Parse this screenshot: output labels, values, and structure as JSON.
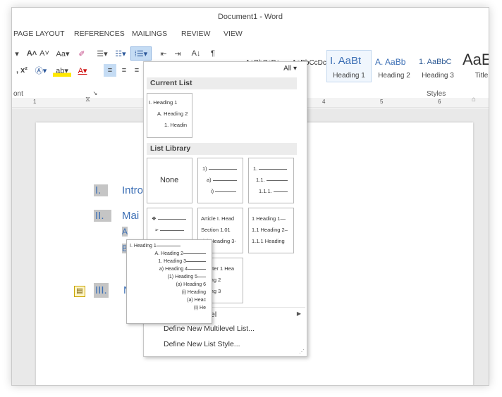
{
  "window": {
    "title": "Document1 - Word"
  },
  "tabs": [
    "PAGE LAYOUT",
    "REFERENCES",
    "MAILINGS",
    "REVIEW",
    "VIEW"
  ],
  "ribbon": {
    "font_group_label": "ont",
    "styles_group_label": "Styles",
    "styles": [
      {
        "sample": "AaBbCcDc",
        "name": ""
      },
      {
        "sample": "AaBbCcDc",
        "name": ""
      },
      {
        "sample": "I. AaBt",
        "name": "Heading 1"
      },
      {
        "sample": "A. AaBb",
        "name": "Heading 2"
      },
      {
        "sample": "1. AaBbC",
        "name": "Heading 3"
      },
      {
        "sample": "AaE",
        "name": "Title"
      }
    ]
  },
  "ruler": {
    "marks": [
      "1",
      "4",
      "5",
      "6"
    ]
  },
  "document": {
    "headings": [
      {
        "num": "I.",
        "text": "Intro"
      },
      {
        "num": "II.",
        "text": "Mai"
      },
      {
        "num": "III.",
        "text": "N"
      }
    ],
    "sub_a": "A",
    "sub_b": "B"
  },
  "dropdown": {
    "filter": "All",
    "current_list_label": "Current List",
    "current_list": [
      "I. Heading 1",
      "A. Heading 2",
      "1. Headin"
    ],
    "list_library_label": "List Library",
    "none_label": "None",
    "lib_row1_b": [
      "1)",
      "a)",
      "i)"
    ],
    "lib_row1_c": [
      "1.",
      "1.1.",
      "1.1.1."
    ],
    "lib_row2_b": [
      "Article I. Head",
      "Section 1.01",
      "(a) Heading 3-"
    ],
    "lib_row2_c": [
      "1 Heading 1—",
      "1.1 Heading 2–",
      "1.1.1 Heading"
    ],
    "lib_row3": [
      "pter 1 Hea",
      "ing 2",
      "ing 3"
    ],
    "change_level": "el",
    "define_multilevel": "Define New Multilevel List...",
    "define_style": "Define New List Style..."
  },
  "preview": [
    "I. Heading 1",
    "A. Heading 2",
    "1. Heading 3",
    "a) Heading 4",
    "(1) Heading 5",
    "(a) Heading 6",
    "(i) Heading",
    "(a) Heac",
    "(i) He"
  ]
}
